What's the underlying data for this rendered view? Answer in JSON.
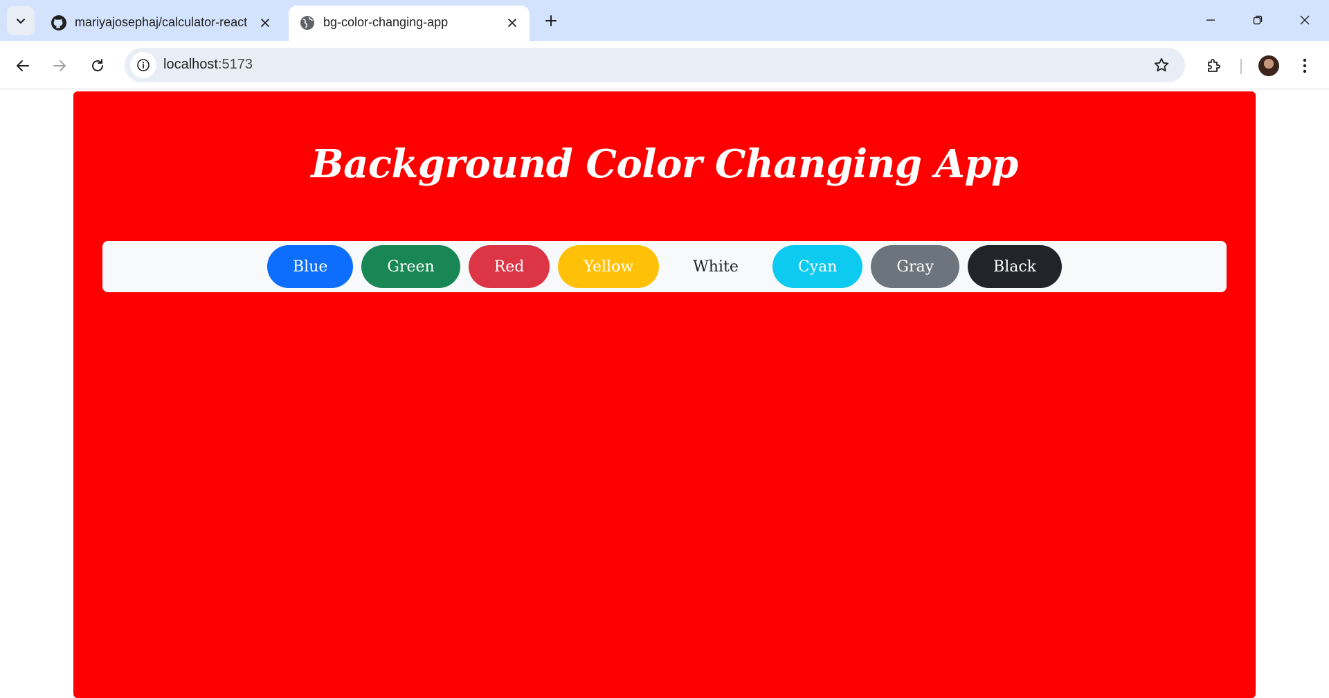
{
  "browser": {
    "tabs": [
      {
        "title": "mariyajosephaj/calculator-react",
        "icon": "github-icon",
        "active": false
      },
      {
        "title": "bg-color-changing-app",
        "icon": "globe-icon",
        "active": true
      }
    ],
    "address": {
      "host": "localhost",
      "port": ":5173"
    }
  },
  "app": {
    "title": "Background Color Changing App",
    "background_color": "#ff0000",
    "colors": [
      {
        "label": "Blue",
        "bg": "#0d6efd",
        "fg": "#ffffff"
      },
      {
        "label": "Green",
        "bg": "#198754",
        "fg": "#ffffff"
      },
      {
        "label": "Red",
        "bg": "#dc3545",
        "fg": "#ffffff"
      },
      {
        "label": "Yellow",
        "bg": "#ffc107",
        "fg": "#ffffff"
      },
      {
        "label": "White",
        "bg": "#f8f9fa",
        "fg": "#212529"
      },
      {
        "label": "Cyan",
        "bg": "#0dcaf0",
        "fg": "#ffffff"
      },
      {
        "label": "Gray",
        "bg": "#6c757d",
        "fg": "#ffffff"
      },
      {
        "label": "Black",
        "bg": "#212529",
        "fg": "#ffffff"
      }
    ]
  }
}
